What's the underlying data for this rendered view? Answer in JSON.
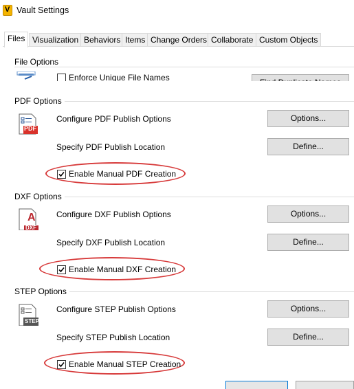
{
  "window": {
    "title": "Vault Settings",
    "app_icon_letter": "V"
  },
  "tabs": [
    {
      "label": "Files"
    },
    {
      "label": "Visualization"
    },
    {
      "label": "Behaviors"
    },
    {
      "label": "Items"
    },
    {
      "label": "Change Orders"
    },
    {
      "label": "Collaborate"
    },
    {
      "label": "Custom Objects"
    }
  ],
  "active_tab": "Files",
  "file_options": {
    "title": "File Options",
    "enforce_label": "Enforce Unique File Names",
    "enforce_checked": false,
    "find_button": "Find Duplicate Names"
  },
  "pdf": {
    "title": "PDF Options",
    "configure_label": "Configure PDF Publish Options",
    "location_label": "Specify PDF Publish Location",
    "options_button": "Options...",
    "define_button": "Define...",
    "manual_label": "Enable Manual PDF Creation",
    "manual_checked": true,
    "icon_text": "PDF"
  },
  "dxf": {
    "title": "DXF Options",
    "configure_label": "Configure DXF Publish Options",
    "location_label": "Specify DXF Publish Location",
    "options_button": "Options...",
    "define_button": "Define...",
    "manual_label": "Enable Manual DXF Creation",
    "manual_checked": true,
    "icon_letter": "A",
    "icon_text": "DXF"
  },
  "step": {
    "title": "STEP Options",
    "configure_label": "Configure STEP Publish Options",
    "location_label": "Specify STEP Publish Location",
    "options_button": "Options...",
    "define_button": "Define...",
    "manual_label": "Enable Manual STEP Creation",
    "manual_checked": true,
    "icon_text": "STEP"
  },
  "colors": {
    "highlight": "#d73a3a",
    "pdf_red": "#d9322b",
    "dxf_red": "#b9262d",
    "step_gray": "#555555"
  }
}
